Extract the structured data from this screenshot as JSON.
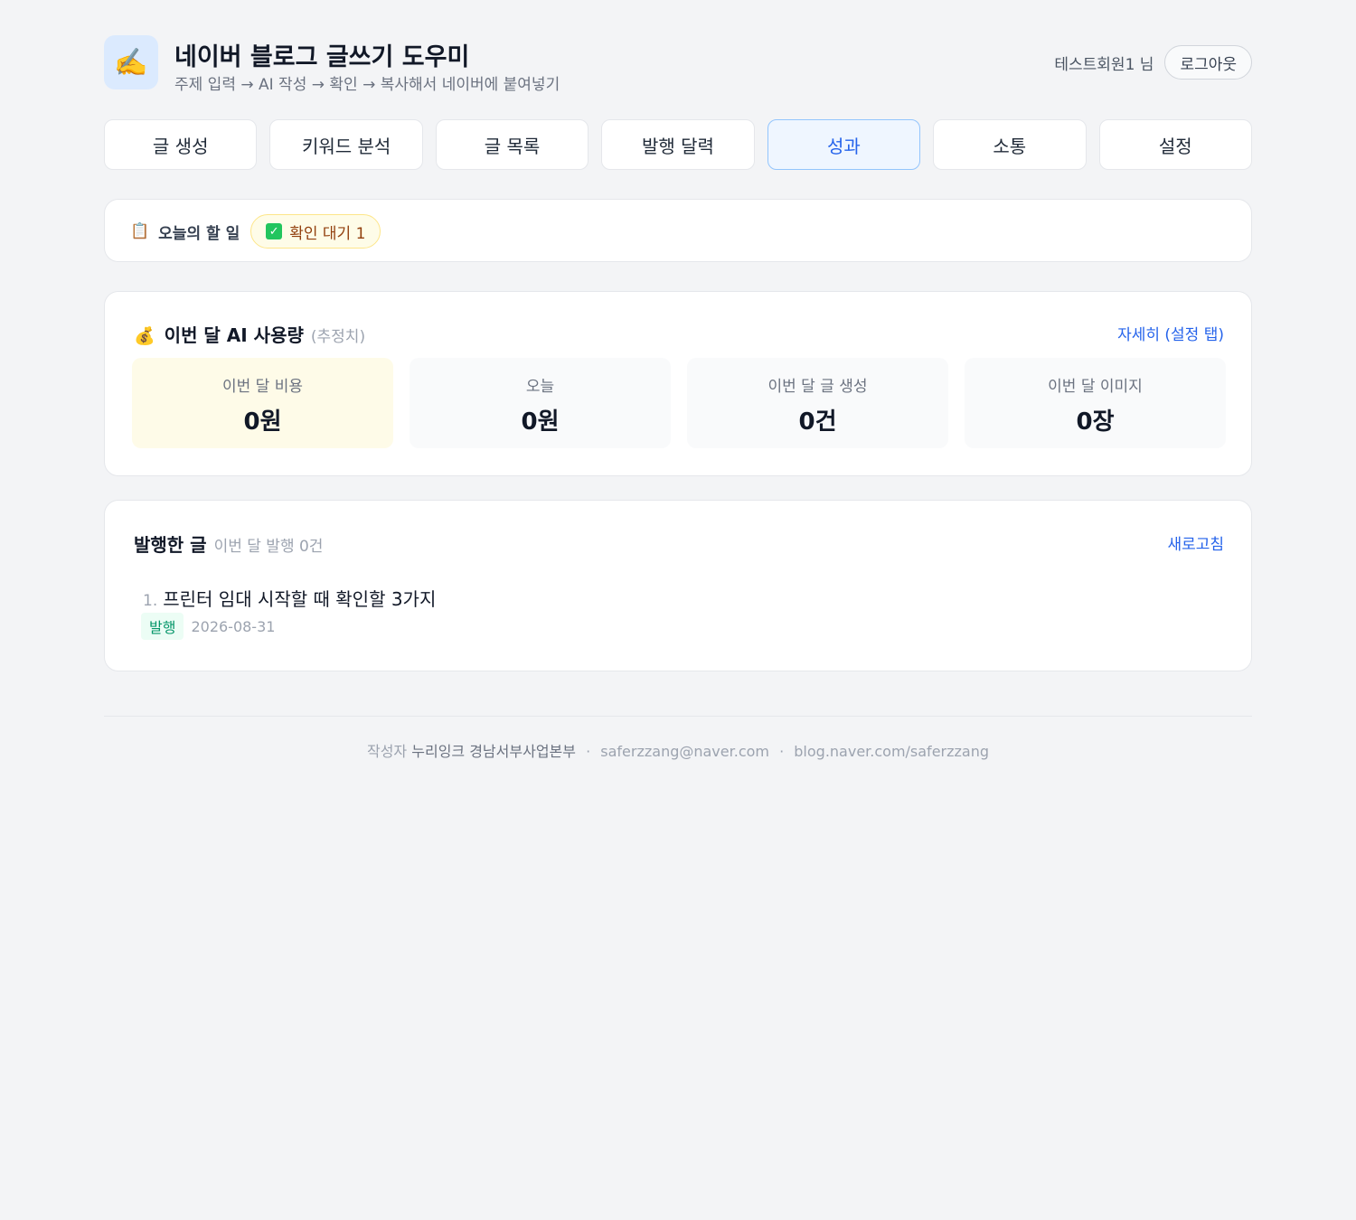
{
  "header": {
    "logo_glyph": "✍️",
    "title": "네이버 블로그 글쓰기 도우미",
    "subtitle": "주제 입력 → AI 작성 → 확인 → 복사해서 네이버에 붙여넣기",
    "user_name": "테스트회원1 님",
    "logout_label": "로그아웃"
  },
  "tabs": [
    {
      "label": "글 생성",
      "active": false
    },
    {
      "label": "키워드 분석",
      "active": false
    },
    {
      "label": "글 목록",
      "active": false
    },
    {
      "label": "발행 달력",
      "active": false
    },
    {
      "label": "성과",
      "active": true
    },
    {
      "label": "소통",
      "active": false
    },
    {
      "label": "설정",
      "active": false
    }
  ],
  "todo": {
    "icon": "clipboard-icon",
    "icon_glyph": "📋",
    "title": "오늘의 할 일",
    "badge_icon": "check-box-icon",
    "badge_label": "확인 대기 1"
  },
  "usage": {
    "icon": "money-bag-icon",
    "icon_glyph": "💰",
    "title": "이번 달 AI 사용량",
    "note": "(추정치)",
    "detail_link": "자세히 (설정 탭)",
    "stats": [
      {
        "label": "이번 달 비용",
        "value": "0원"
      },
      {
        "label": "오늘",
        "value": "0원"
      },
      {
        "label": "이번 달 글 생성",
        "value": "0건"
      },
      {
        "label": "이번 달 이미지",
        "value": "0장"
      }
    ]
  },
  "posts": {
    "title": "발행한 글",
    "count_text": "이번 달 발행 0건",
    "refresh_label": "새로고침",
    "items": [
      {
        "number": "1.",
        "title": "프린터 임대 시작할 때 확인할 3가지",
        "status": "발행",
        "date": "2026-08-31"
      }
    ]
  },
  "footer": {
    "author_prefix": "작성자",
    "org": "누리잉크 경남서부사업본부",
    "separator": "·",
    "email": "saferzzang@naver.com",
    "blog": "blog.naver.com/saferzzang"
  },
  "colors": {
    "background": "#f3f4f6",
    "accent": "#2563eb",
    "active_tab_bg": "#eff6ff",
    "badge_bg": "#fefce8",
    "published_green": "#059669"
  }
}
